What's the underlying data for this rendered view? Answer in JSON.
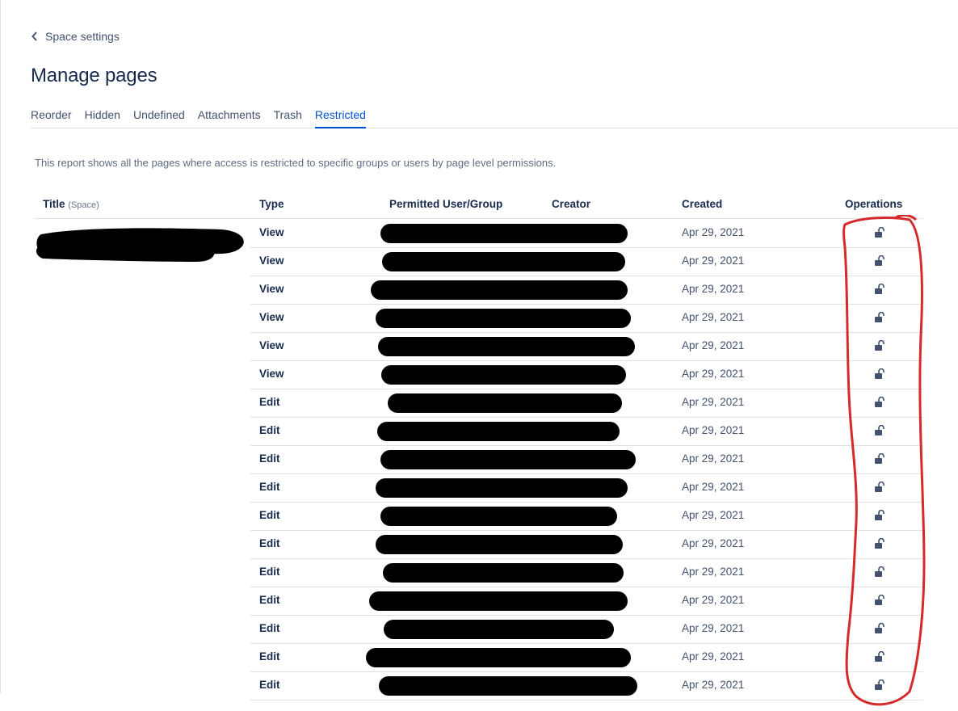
{
  "back_link": "Space settings",
  "page_title": "Manage pages",
  "tabs": [
    {
      "label": "Reorder"
    },
    {
      "label": "Hidden"
    },
    {
      "label": "Undefined"
    },
    {
      "label": "Attachments"
    },
    {
      "label": "Trash"
    },
    {
      "label": "Restricted",
      "active": true
    }
  ],
  "description": "This report shows all the pages where access is restricted to specific groups or users by page level permissions.",
  "columns": {
    "title": "Title",
    "space": "(Space)",
    "type": "Type",
    "permitted": "Permitted User/Group",
    "creator": "Creator",
    "created": "Created",
    "operations": "Operations"
  },
  "rows": [
    {
      "type": "View",
      "created": "Apr 29, 2021"
    },
    {
      "type": "View",
      "created": "Apr 29, 2021"
    },
    {
      "type": "View",
      "created": "Apr 29, 2021"
    },
    {
      "type": "View",
      "created": "Apr 29, 2021"
    },
    {
      "type": "View",
      "created": "Apr 29, 2021"
    },
    {
      "type": "View",
      "created": "Apr 29, 2021"
    },
    {
      "type": "Edit",
      "created": "Apr 29, 2021"
    },
    {
      "type": "Edit",
      "created": "Apr 29, 2021"
    },
    {
      "type": "Edit",
      "created": "Apr 29, 2021"
    },
    {
      "type": "Edit",
      "created": "Apr 29, 2021"
    },
    {
      "type": "Edit",
      "created": "Apr 29, 2021"
    },
    {
      "type": "Edit",
      "created": "Apr 29, 2021"
    },
    {
      "type": "Edit",
      "created": "Apr 29, 2021"
    },
    {
      "type": "Edit",
      "created": "Apr 29, 2021"
    },
    {
      "type": "Edit",
      "created": "Apr 29, 2021"
    },
    {
      "type": "Edit",
      "created": "Apr 29, 2021"
    },
    {
      "type": "Edit",
      "created": "Apr 29, 2021"
    }
  ],
  "icons": {
    "back": "chevron-left-icon",
    "operation": "unlock-icon"
  },
  "colors": {
    "accent": "#0052cc",
    "annotation": "#d42a2a",
    "redaction": "#000000"
  }
}
